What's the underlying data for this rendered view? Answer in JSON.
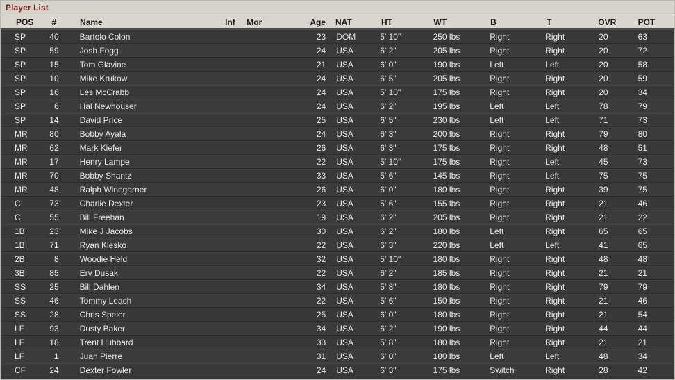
{
  "window": {
    "title": "Player List"
  },
  "table": {
    "columns": [
      {
        "key": "pos",
        "label": "POS"
      },
      {
        "key": "num",
        "label": "#"
      },
      {
        "key": "name",
        "label": "Name"
      },
      {
        "key": "inf",
        "label": "Inf"
      },
      {
        "key": "mor",
        "label": "Mor"
      },
      {
        "key": "age",
        "label": "Age"
      },
      {
        "key": "nat",
        "label": "NAT"
      },
      {
        "key": "ht",
        "label": "HT"
      },
      {
        "key": "wt",
        "label": "WT"
      },
      {
        "key": "b",
        "label": "B"
      },
      {
        "key": "t",
        "label": "T"
      },
      {
        "key": "ovr",
        "label": "OVR"
      },
      {
        "key": "pot",
        "label": "POT"
      }
    ],
    "rows": [
      {
        "pos": "SP",
        "num": "40",
        "name": "Bartolo Colon",
        "inf": "",
        "mor": "",
        "age": "23",
        "nat": "DOM",
        "ht": "5' 10\"",
        "wt": "250 lbs",
        "b": "Right",
        "t": "Right",
        "ovr": "20",
        "pot": "63"
      },
      {
        "pos": "SP",
        "num": "59",
        "name": "Josh Fogg",
        "inf": "",
        "mor": "",
        "age": "24",
        "nat": "USA",
        "ht": "6' 2\"",
        "wt": "205 lbs",
        "b": "Right",
        "t": "Right",
        "ovr": "20",
        "pot": "72"
      },
      {
        "pos": "SP",
        "num": "15",
        "name": "Tom Glavine",
        "inf": "",
        "mor": "",
        "age": "21",
        "nat": "USA",
        "ht": "6' 0\"",
        "wt": "190 lbs",
        "b": "Left",
        "t": "Left",
        "ovr": "20",
        "pot": "58"
      },
      {
        "pos": "SP",
        "num": "10",
        "name": "Mike Krukow",
        "inf": "",
        "mor": "",
        "age": "24",
        "nat": "USA",
        "ht": "6' 5\"",
        "wt": "205 lbs",
        "b": "Right",
        "t": "Right",
        "ovr": "20",
        "pot": "59"
      },
      {
        "pos": "SP",
        "num": "16",
        "name": "Les McCrabb",
        "inf": "",
        "mor": "",
        "age": "24",
        "nat": "USA",
        "ht": "5' 10\"",
        "wt": "175 lbs",
        "b": "Right",
        "t": "Right",
        "ovr": "20",
        "pot": "34"
      },
      {
        "pos": "SP",
        "num": "6",
        "name": "Hal Newhouser",
        "inf": "",
        "mor": "",
        "age": "24",
        "nat": "USA",
        "ht": "6' 2\"",
        "wt": "195 lbs",
        "b": "Left",
        "t": "Left",
        "ovr": "78",
        "pot": "79"
      },
      {
        "pos": "SP",
        "num": "14",
        "name": "David Price",
        "inf": "",
        "mor": "",
        "age": "25",
        "nat": "USA",
        "ht": "6' 5\"",
        "wt": "230 lbs",
        "b": "Left",
        "t": "Left",
        "ovr": "71",
        "pot": "73"
      },
      {
        "pos": "MR",
        "num": "80",
        "name": "Bobby Ayala",
        "inf": "",
        "mor": "",
        "age": "24",
        "nat": "USA",
        "ht": "6' 3\"",
        "wt": "200 lbs",
        "b": "Right",
        "t": "Right",
        "ovr": "79",
        "pot": "80"
      },
      {
        "pos": "MR",
        "num": "62",
        "name": "Mark Kiefer",
        "inf": "",
        "mor": "",
        "age": "26",
        "nat": "USA",
        "ht": "6' 3\"",
        "wt": "175 lbs",
        "b": "Right",
        "t": "Right",
        "ovr": "48",
        "pot": "51"
      },
      {
        "pos": "MR",
        "num": "17",
        "name": "Henry Lampe",
        "inf": "",
        "mor": "",
        "age": "22",
        "nat": "USA",
        "ht": "5' 10\"",
        "wt": "175 lbs",
        "b": "Right",
        "t": "Left",
        "ovr": "45",
        "pot": "73"
      },
      {
        "pos": "MR",
        "num": "70",
        "name": "Bobby Shantz",
        "inf": "",
        "mor": "",
        "age": "33",
        "nat": "USA",
        "ht": "5' 6\"",
        "wt": "145 lbs",
        "b": "Right",
        "t": "Left",
        "ovr": "75",
        "pot": "75"
      },
      {
        "pos": "MR",
        "num": "48",
        "name": "Ralph Winegarner",
        "inf": "",
        "mor": "",
        "age": "26",
        "nat": "USA",
        "ht": "6' 0\"",
        "wt": "180 lbs",
        "b": "Right",
        "t": "Right",
        "ovr": "39",
        "pot": "75"
      },
      {
        "pos": "C",
        "num": "73",
        "name": "Charlie Dexter",
        "inf": "",
        "mor": "",
        "age": "23",
        "nat": "USA",
        "ht": "5' 6\"",
        "wt": "155 lbs",
        "b": "Right",
        "t": "Right",
        "ovr": "21",
        "pot": "46"
      },
      {
        "pos": "C",
        "num": "55",
        "name": "Bill Freehan",
        "inf": "",
        "mor": "",
        "age": "19",
        "nat": "USA",
        "ht": "6' 2\"",
        "wt": "205 lbs",
        "b": "Right",
        "t": "Right",
        "ovr": "21",
        "pot": "22"
      },
      {
        "pos": "1B",
        "num": "23",
        "name": "Mike J Jacobs",
        "inf": "",
        "mor": "",
        "age": "30",
        "nat": "USA",
        "ht": "6' 2\"",
        "wt": "180 lbs",
        "b": "Left",
        "t": "Right",
        "ovr": "65",
        "pot": "65"
      },
      {
        "pos": "1B",
        "num": "71",
        "name": "Ryan Klesko",
        "inf": "",
        "mor": "",
        "age": "22",
        "nat": "USA",
        "ht": "6' 3\"",
        "wt": "220 lbs",
        "b": "Left",
        "t": "Left",
        "ovr": "41",
        "pot": "65"
      },
      {
        "pos": "2B",
        "num": "8",
        "name": "Woodie Held",
        "inf": "",
        "mor": "",
        "age": "32",
        "nat": "USA",
        "ht": "5' 10\"",
        "wt": "180 lbs",
        "b": "Right",
        "t": "Right",
        "ovr": "48",
        "pot": "48"
      },
      {
        "pos": "3B",
        "num": "85",
        "name": "Erv Dusak",
        "inf": "",
        "mor": "",
        "age": "22",
        "nat": "USA",
        "ht": "6' 2\"",
        "wt": "185 lbs",
        "b": "Right",
        "t": "Right",
        "ovr": "21",
        "pot": "21"
      },
      {
        "pos": "SS",
        "num": "25",
        "name": "Bill Dahlen",
        "inf": "",
        "mor": "",
        "age": "34",
        "nat": "USA",
        "ht": "5' 8\"",
        "wt": "180 lbs",
        "b": "Right",
        "t": "Right",
        "ovr": "79",
        "pot": "79"
      },
      {
        "pos": "SS",
        "num": "46",
        "name": "Tommy Leach",
        "inf": "",
        "mor": "",
        "age": "22",
        "nat": "USA",
        "ht": "5' 6\"",
        "wt": "150 lbs",
        "b": "Right",
        "t": "Right",
        "ovr": "21",
        "pot": "46"
      },
      {
        "pos": "SS",
        "num": "28",
        "name": "Chris Speier",
        "inf": "",
        "mor": "",
        "age": "25",
        "nat": "USA",
        "ht": "6' 0\"",
        "wt": "180 lbs",
        "b": "Right",
        "t": "Right",
        "ovr": "21",
        "pot": "54"
      },
      {
        "pos": "LF",
        "num": "93",
        "name": "Dusty Baker",
        "inf": "",
        "mor": "",
        "age": "34",
        "nat": "USA",
        "ht": "6' 2\"",
        "wt": "190 lbs",
        "b": "Right",
        "t": "Right",
        "ovr": "44",
        "pot": "44"
      },
      {
        "pos": "LF",
        "num": "18",
        "name": "Trent Hubbard",
        "inf": "",
        "mor": "",
        "age": "33",
        "nat": "USA",
        "ht": "5' 8\"",
        "wt": "180 lbs",
        "b": "Right",
        "t": "Right",
        "ovr": "21",
        "pot": "21"
      },
      {
        "pos": "LF",
        "num": "1",
        "name": "Juan Pierre",
        "inf": "",
        "mor": "",
        "age": "31",
        "nat": "USA",
        "ht": "6' 0\"",
        "wt": "180 lbs",
        "b": "Left",
        "t": "Left",
        "ovr": "48",
        "pot": "34"
      },
      {
        "pos": "CF",
        "num": "24",
        "name": "Dexter Fowler",
        "inf": "",
        "mor": "",
        "age": "24",
        "nat": "USA",
        "ht": "6' 3\"",
        "wt": "175 lbs",
        "b": "Switch",
        "t": "Right",
        "ovr": "28",
        "pot": "42"
      }
    ]
  },
  "colors": {
    "titlebar_bg": "#d6d3cb",
    "title_text": "#7b1c17",
    "header_bg": "#d9d6ce",
    "row_bg": "#383838",
    "row_text": "#e9e9e9"
  }
}
